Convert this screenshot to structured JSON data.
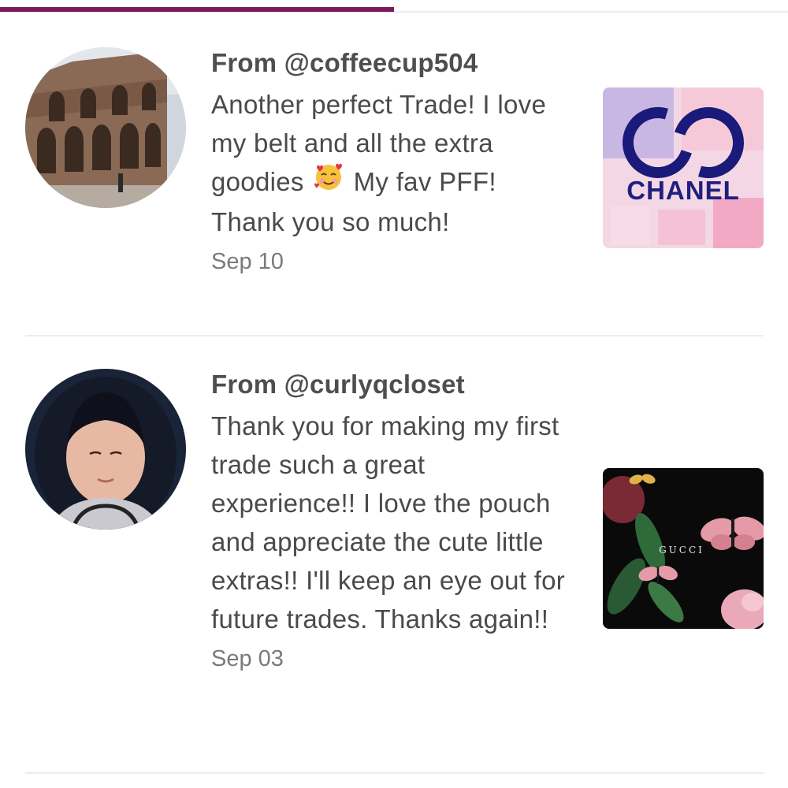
{
  "tabs": {
    "active_indicator_color": "#7b1a5c"
  },
  "reviews": [
    {
      "from": "From @coffeecup504",
      "text_before_emoji": "Another perfect Trade! I love my belt and all the extra goodies ",
      "emoji": "smiling-face-with-hearts",
      "text_after_emoji": " My fav PFF! Thank you so much!",
      "date": "Sep 10",
      "avatar": "colosseum-photo",
      "thumbnail": {
        "icon": "chanel-collage",
        "brand_text": "CHANEL"
      }
    },
    {
      "from": "From @curlyqcloset",
      "text": "Thank you for making my first trade such a great experience!! I love the pouch and appreciate the cute little extras!! I'll keep an eye out for future trades. Thanks again!!",
      "date": "Sep 03",
      "avatar": "woman-curly-hair-photo",
      "thumbnail": {
        "icon": "gucci-butterfly-print",
        "brand_text": "GUCCI"
      }
    }
  ]
}
